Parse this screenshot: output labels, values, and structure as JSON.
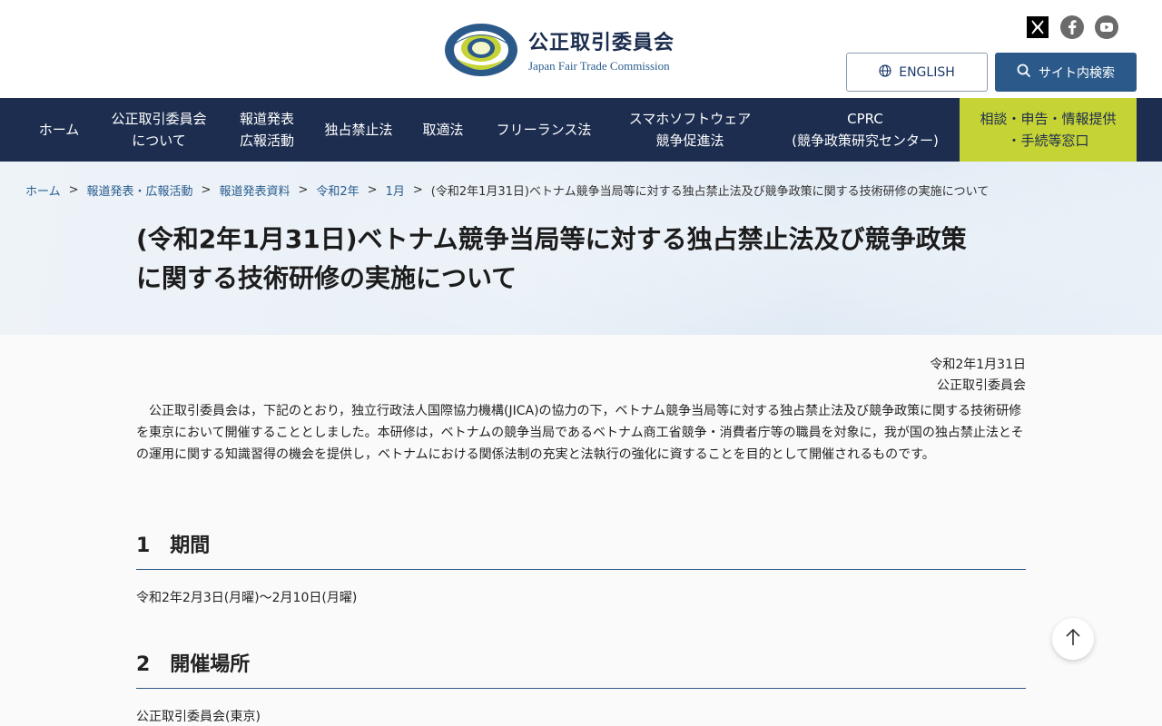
{
  "header": {
    "logo_ja": "公正取引委員会",
    "logo_en": "Japan Fair Trade Commission",
    "logo_ring_text": "JAPAN FAIR TRADE COMMISSION",
    "english_label": "ENGLISH",
    "search_label": "サイト内検索",
    "social": [
      "x-icon",
      "facebook-icon",
      "youtube-icon"
    ]
  },
  "nav": {
    "items": [
      {
        "line1": "ホーム",
        "line2": ""
      },
      {
        "line1": "公正取引委員会",
        "line2": "について"
      },
      {
        "line1": "報道発表",
        "line2": "広報活動"
      },
      {
        "line1": "独占禁止法",
        "line2": ""
      },
      {
        "line1": "取適法",
        "line2": ""
      },
      {
        "line1": "フリーランス法",
        "line2": ""
      },
      {
        "line1": "スマホソフトウェア",
        "line2": "競争促進法"
      },
      {
        "line1": "CPRC",
        "line2": "(競争政策研究センター)"
      }
    ],
    "consult": {
      "line1": "相談・申告・情報提供",
      "line2": "・手続等窓口"
    }
  },
  "breadcrumb": {
    "items": [
      "ホーム",
      "報道発表・広報活動",
      "報道発表資料",
      "令和2年",
      "1月"
    ],
    "current": "(令和2年1月31日)ベトナム競争当局等に対する独占禁止法及び競争政策に関する技術研修の実施について"
  },
  "page": {
    "title_line1": "(令和2年1月31日)ベトナム競争当局等に対する独占禁止法及び競争政策",
    "title_line2": "に関する技術研修の実施について",
    "date": "令和2年1月31日",
    "issuer": "公正取引委員会",
    "intro": "公正取引委員会は，下記のとおり，独立行政法人国際協力機構(JICA)の協力の下，ベトナム競争当局等に対する独占禁止法及び競争政策に関する技術研修を東京において開催することとしました。本研修は，ベトナムの競争当局であるベトナム商工省競争・消費者庁等の職員を対象に，我が国の独占禁止法とその運用に関する知識習得の機会を提供し，ベトナムにおける関係法制の充実と法執行の強化に資することを目的として開催されるものです。",
    "sections": [
      {
        "heading": "1　期間",
        "body": "令和2年2月3日(月曜)～2月10日(月曜)"
      },
      {
        "heading": "2　開催場所",
        "body": "公正取引委員会(東京)"
      }
    ]
  },
  "colors": {
    "navy": "#1c2d4f",
    "accent_blue": "#2b5a8a",
    "consult_green": "#c6d335"
  }
}
